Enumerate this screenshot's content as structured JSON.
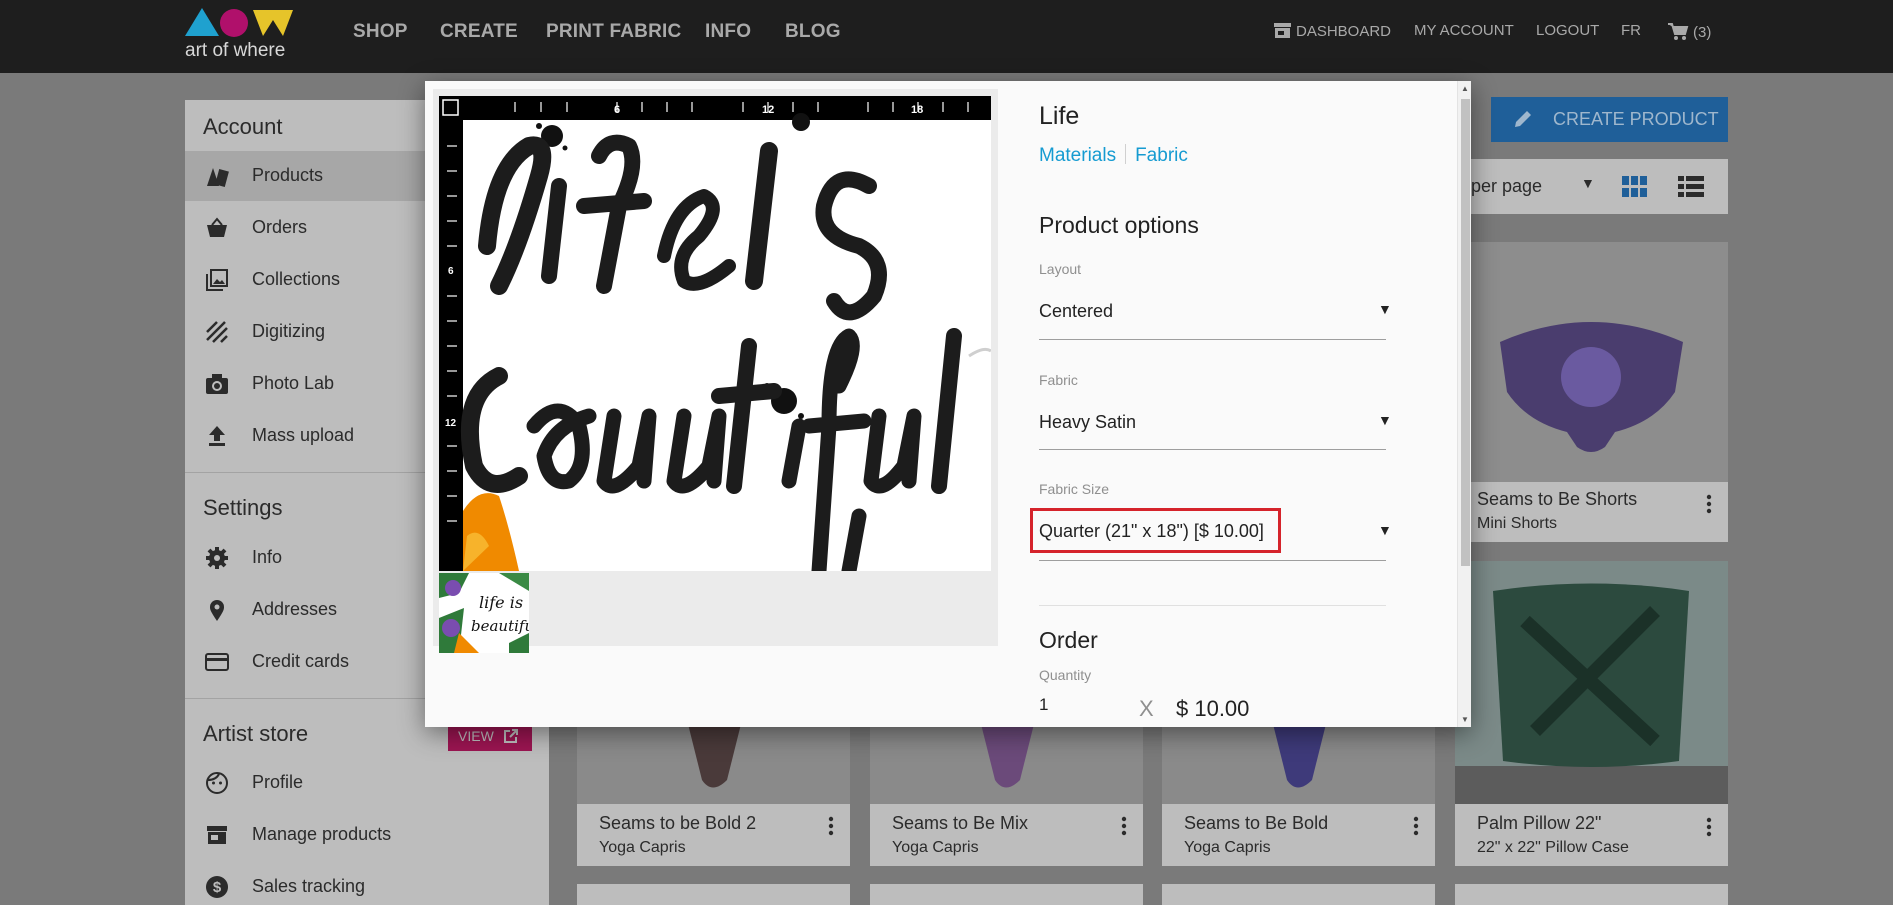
{
  "colors": {
    "navbar": "#1e1e1e",
    "accent_blue": "#159bd1",
    "create_button": "#1f5f99",
    "view_button": "#9c1552",
    "highlight": "#d5232b"
  },
  "nav": {
    "logo_text": "art of where",
    "items": [
      "SHOP",
      "CREATE",
      "PRINT FABRIC",
      "INFO",
      "BLOG"
    ],
    "dashboard": "DASHBOARD",
    "my_account": "MY ACCOUNT",
    "logout": "LOGOUT",
    "lang": "FR",
    "cart_count": "(3)"
  },
  "sidebar": {
    "account_heading": "Account",
    "account_items": [
      {
        "label": "Products",
        "icon": "products-icon"
      },
      {
        "label": "Orders",
        "icon": "basket-icon"
      },
      {
        "label": "Collections",
        "icon": "collections-icon"
      },
      {
        "label": "Digitizing",
        "icon": "digitizing-icon"
      },
      {
        "label": "Photo Lab",
        "icon": "camera-icon"
      },
      {
        "label": "Mass upload",
        "icon": "upload-icon"
      }
    ],
    "settings_heading": "Settings",
    "settings_items": [
      {
        "label": "Info",
        "icon": "gear-icon"
      },
      {
        "label": "Addresses",
        "icon": "location-icon"
      },
      {
        "label": "Credit cards",
        "icon": "credit-card-icon"
      }
    ],
    "artist_heading": "Artist store",
    "view_label": "VIEW",
    "artist_items": [
      {
        "label": "Profile",
        "icon": "face-icon"
      },
      {
        "label": "Manage products",
        "icon": "store-icon"
      },
      {
        "label": "Sales tracking",
        "icon": "dollar-icon"
      }
    ]
  },
  "main": {
    "create_button": "CREATE PRODUCT",
    "per_page": "per page",
    "cards": [
      {
        "title": "Seams to Be Shorts",
        "subtitle": "Mini Shorts"
      },
      {
        "title": "Seams to be Bold 2",
        "subtitle": "Yoga Capris"
      },
      {
        "title": "Seams to Be Mix",
        "subtitle": "Yoga Capris"
      },
      {
        "title": "Seams to Be Bold",
        "subtitle": "Yoga Capris"
      },
      {
        "title": "Palm Pillow 22\"",
        "subtitle": "22\" x 22\" Pillow Case"
      }
    ]
  },
  "modal": {
    "ruler_marks": [
      "6",
      "12",
      "18"
    ],
    "ruler_side_marks": [
      "6",
      "12"
    ],
    "title": "Life",
    "links": [
      "Materials",
      "Fabric"
    ],
    "options_heading": "Product options",
    "layout": {
      "label": "Layout",
      "value": "Centered"
    },
    "fabric": {
      "label": "Fabric",
      "value": "Heavy Satin"
    },
    "fabric_size": {
      "label": "Fabric Size",
      "value": "Quarter (21\" x 18\") [$ 10.00]"
    },
    "order_heading": "Order",
    "quantity_label": "Quantity",
    "quantity_value": "1",
    "times": "X",
    "price": "$ 10.00"
  }
}
